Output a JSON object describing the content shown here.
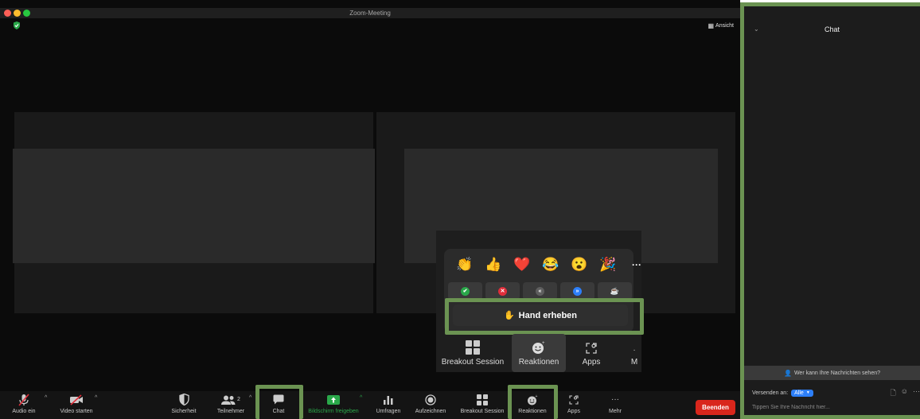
{
  "window": {
    "title": "Zoom-Meeting",
    "view_label": "Ansicht",
    "traffic_colors": [
      "#fe5f57",
      "#febc2e",
      "#28c840"
    ]
  },
  "reactions": {
    "emojis": [
      "👏",
      "👍",
      "❤️",
      "😂",
      "😮",
      "🎉"
    ],
    "more_label": "···",
    "status": [
      {
        "icon": "check-icon",
        "glyph": "✔",
        "color": "#2aa84a"
      },
      {
        "icon": "x-icon",
        "glyph": "✕",
        "color": "#e02e3a"
      },
      {
        "icon": "slower-icon",
        "glyph": "«",
        "color": "#5e5e5e"
      },
      {
        "icon": "faster-icon",
        "glyph": "»",
        "color": "#2d7ff9"
      },
      {
        "icon": "coffee-icon",
        "glyph": "☕",
        "color": "transparent"
      }
    ],
    "hand_label": "Hand erheben",
    "hand_emoji": "✋"
  },
  "popup_bar": {
    "breakout": "Breakout Session",
    "reactions": "Reaktionen",
    "apps": "Apps",
    "more": "M"
  },
  "toolbar": {
    "audio": "Audio ein",
    "video": "Video starten",
    "security": "Sicherheit",
    "participants": "Teilnehmer",
    "participants_count": "2",
    "chat": "Chat",
    "share": "Bildschirm freigeben",
    "polls": "Umfragen",
    "record": "Aufzeichnen",
    "breakout": "Breakout Session",
    "reactions": "Reaktionen",
    "apps": "Apps",
    "more": "Mehr",
    "end": "Beenden",
    "share_color": "#2aa84a",
    "end_color": "#d9261c"
  },
  "chat": {
    "title": "Chat",
    "who_can_see": "Wer kann Ihre Nachrichten sehen?",
    "send_to_label": "Versenden an:",
    "send_to_value": "Alle",
    "placeholder": "Tippen Sie Ihre Nachricht hier..."
  },
  "colors": {
    "highlight": "#6b9352",
    "accent": "#2d7ff9"
  }
}
